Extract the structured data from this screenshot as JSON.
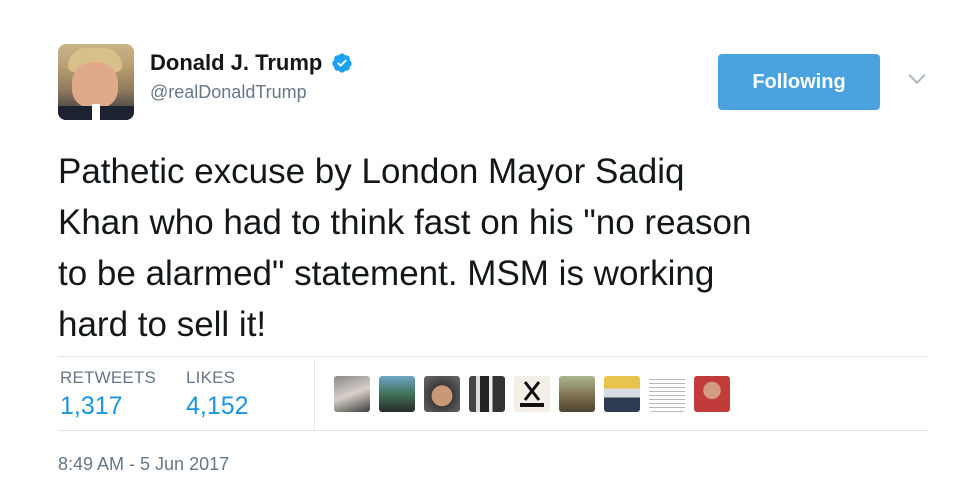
{
  "author": {
    "display_name": "Donald J. Trump",
    "screen_name": "@realDonaldTrump",
    "verified": true
  },
  "follow_button": {
    "label": "Following"
  },
  "tweet": {
    "lines": [
      "Pathetic excuse by London Mayor Sadiq",
      "Khan who had to think fast on his \"no reason",
      "to be alarmed\" statement. MSM is working",
      "hard to sell it!"
    ]
  },
  "stats": {
    "retweets_label": "RETWEETS",
    "retweets_value": "1,317",
    "likes_label": "LIKES",
    "likes_value": "4,152"
  },
  "likers": [
    {
      "icon": "liker-avatar-1"
    },
    {
      "icon": "liker-avatar-2"
    },
    {
      "icon": "liker-avatar-3"
    },
    {
      "icon": "liker-avatar-4"
    },
    {
      "icon": "liker-avatar-5"
    },
    {
      "icon": "liker-avatar-6"
    },
    {
      "icon": "liker-avatar-7"
    },
    {
      "icon": "liker-avatar-8"
    },
    {
      "icon": "liker-avatar-9"
    }
  ],
  "timestamp": "8:49 AM - 5 Jun 2017",
  "colors": {
    "accent": "#1b95e0",
    "button": "#4aa3df",
    "muted": "#657786",
    "text": "#14171a",
    "divider": "#e1e8ed"
  }
}
